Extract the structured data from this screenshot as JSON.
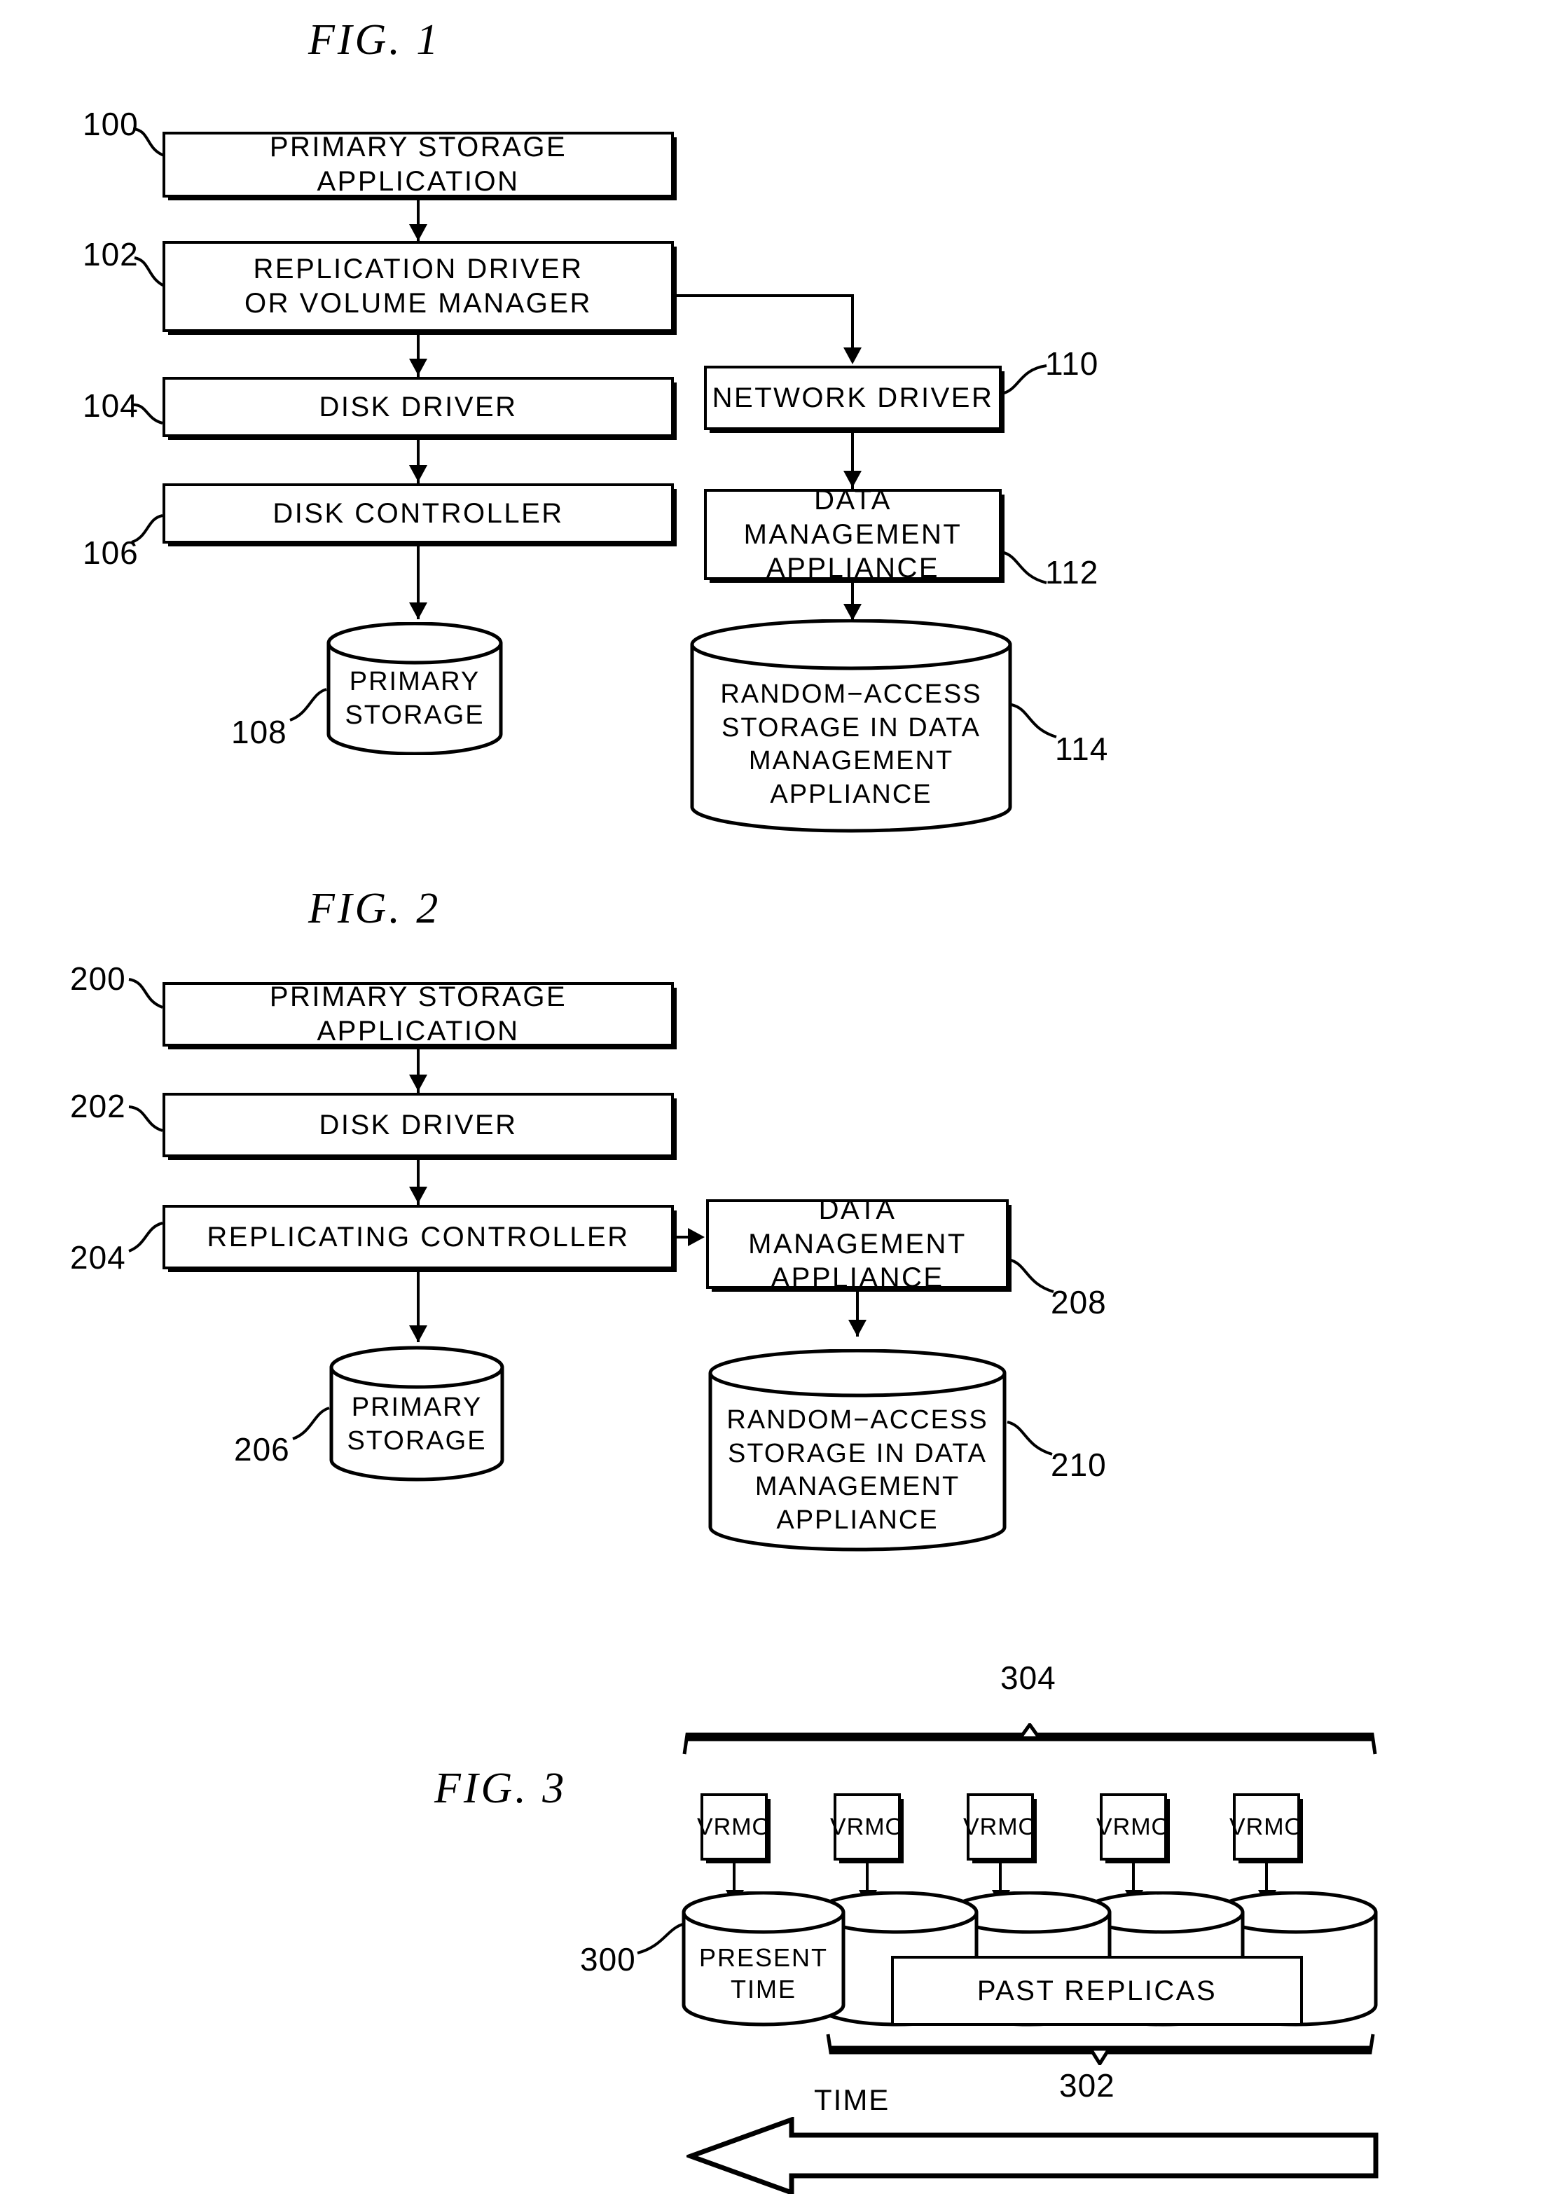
{
  "document": {
    "type": "patent-drawing-sheet",
    "figures": [
      {
        "title": "FIG.  1",
        "nodes": [
          {
            "ref": "100",
            "label": "PRIMARY STORAGE APPLICATION",
            "shape": "box"
          },
          {
            "ref": "102",
            "label": "REPLICATION DRIVER\nOR VOLUME MANAGER",
            "shape": "box"
          },
          {
            "ref": "104",
            "label": "DISK DRIVER",
            "shape": "box"
          },
          {
            "ref": "106",
            "label": "DISK CONTROLLER",
            "shape": "box"
          },
          {
            "ref": "108",
            "label": "PRIMARY\nSTORAGE",
            "shape": "cylinder"
          },
          {
            "ref": "110",
            "label": "NETWORK DRIVER",
            "shape": "box"
          },
          {
            "ref": "112",
            "label": "DATA MANAGEMENT\nAPPLIANCE",
            "shape": "box"
          },
          {
            "ref": "114",
            "label": "RANDOM−ACCESS\nSTORAGE IN DATA\nMANAGEMENT\nAPPLIANCE",
            "shape": "cylinder"
          }
        ],
        "edges": [
          {
            "from": "100",
            "to": "102"
          },
          {
            "from": "102",
            "to": "104"
          },
          {
            "from": "104",
            "to": "106"
          },
          {
            "from": "106",
            "to": "108"
          },
          {
            "from": "102",
            "to": "110"
          },
          {
            "from": "110",
            "to": "112"
          },
          {
            "from": "112",
            "to": "114"
          }
        ]
      },
      {
        "title": "FIG.  2",
        "nodes": [
          {
            "ref": "200",
            "label": "PRIMARY STORAGE APPLICATION",
            "shape": "box"
          },
          {
            "ref": "202",
            "label": "DISK DRIVER",
            "shape": "box"
          },
          {
            "ref": "204",
            "label": "REPLICATING CONTROLLER",
            "shape": "box"
          },
          {
            "ref": "206",
            "label": "PRIMARY\nSTORAGE",
            "shape": "cylinder"
          },
          {
            "ref": "208",
            "label": "DATA MANAGEMENT\nAPPLIANCE",
            "shape": "box"
          },
          {
            "ref": "210",
            "label": "RANDOM−ACCESS\nSTORAGE IN DATA\nMANAGEMENT\nAPPLIANCE",
            "shape": "cylinder"
          }
        ],
        "edges": [
          {
            "from": "200",
            "to": "202"
          },
          {
            "from": "202",
            "to": "204"
          },
          {
            "from": "204",
            "to": "206"
          },
          {
            "from": "204",
            "to": "208"
          },
          {
            "from": "208",
            "to": "210"
          }
        ]
      },
      {
        "title": "FIG.  3",
        "nodes": [
          {
            "ref": "300",
            "label": "PRESENT\nTIME",
            "shape": "cylinder"
          },
          {
            "ref": "302",
            "label": "",
            "shape": "brace-below"
          },
          {
            "ref": "304",
            "label": "",
            "shape": "brace-above"
          }
        ],
        "vrmo_boxes": [
          "VRMO",
          "VRMO",
          "VRMO",
          "VRMO",
          "VRMO"
        ],
        "past_replicas_label": "PAST REPLICAS",
        "time_axis_label": "TIME"
      }
    ]
  },
  "fig1": {
    "title": "FIG.  1",
    "box100": "PRIMARY STORAGE APPLICATION",
    "box102_line1": "REPLICATION DRIVER",
    "box102_line2": "OR VOLUME MANAGER",
    "box104": "DISK DRIVER",
    "box106": "DISK CONTROLLER",
    "cyl108_line1": "PRIMARY",
    "cyl108_line2": "STORAGE",
    "box110": "NETWORK DRIVER",
    "box112_line1": "DATA MANAGEMENT",
    "box112_line2": "APPLIANCE",
    "cyl114_line1": "RANDOM−ACCESS",
    "cyl114_line2": "STORAGE IN DATA",
    "cyl114_line3": "MANAGEMENT",
    "cyl114_line4": "APPLIANCE",
    "ref100": "100",
    "ref102": "102",
    "ref104": "104",
    "ref106": "106",
    "ref108": "108",
    "ref110": "110",
    "ref112": "112",
    "ref114": "114"
  },
  "fig2": {
    "title": "FIG.  2",
    "box200": "PRIMARY STORAGE APPLICATION",
    "box202": "DISK DRIVER",
    "box204": "REPLICATING CONTROLLER",
    "cyl206_line1": "PRIMARY",
    "cyl206_line2": "STORAGE",
    "box208_line1": "DATA MANAGEMENT",
    "box208_line2": "APPLIANCE",
    "cyl210_line1": "RANDOM−ACCESS",
    "cyl210_line2": "STORAGE IN DATA",
    "cyl210_line3": "MANAGEMENT",
    "cyl210_line4": "APPLIANCE",
    "ref200": "200",
    "ref202": "202",
    "ref204": "204",
    "ref206": "206",
    "ref208": "208",
    "ref210": "210"
  },
  "fig3": {
    "title": "FIG.  3",
    "vrmo1": "VRMO",
    "vrmo2": "VRMO",
    "vrmo3": "VRMO",
    "vrmo4": "VRMO",
    "vrmo5": "VRMO",
    "cyl300_line1": "PRESENT",
    "cyl300_line2": "TIME",
    "past_replicas": "PAST REPLICAS",
    "time_label": "TIME",
    "ref300": "300",
    "ref302": "302",
    "ref304": "304"
  },
  "colors": {
    "ink": "#000000",
    "paper": "#ffffff"
  }
}
